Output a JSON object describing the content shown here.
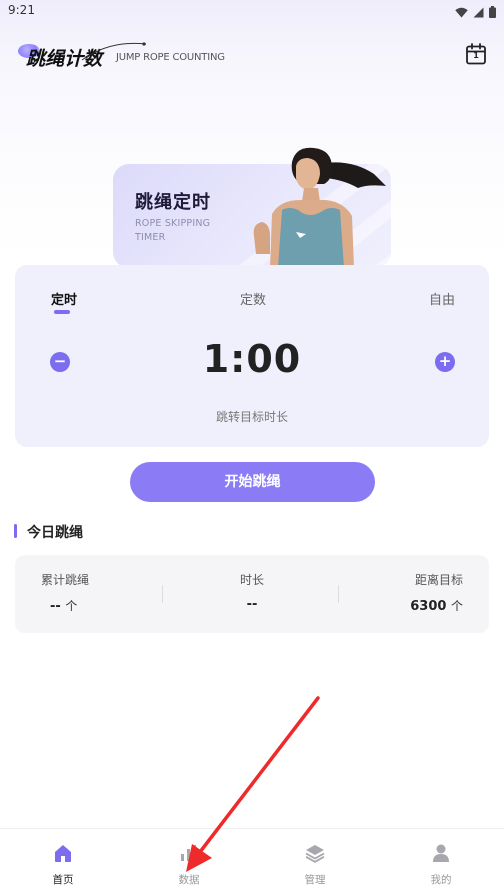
{
  "status_bar": {
    "time": "9:21",
    "icons": [
      "wifi-icon",
      "signal-icon",
      "battery-icon"
    ]
  },
  "header": {
    "logo_text": "跳绳计数",
    "logo_subtitle": "JUMP ROPE COUNTING",
    "calendar_day": "1"
  },
  "banner": {
    "title": "跳绳定时",
    "subtitle_line1": "ROPE SKIPPING",
    "subtitle_line2": "TIMER"
  },
  "timer": {
    "modes": [
      "定时",
      "定数",
      "自由"
    ],
    "active_mode": "定时",
    "value": "1:00",
    "hint": "跳转目标时长",
    "decrease_symbol": "−",
    "increase_symbol": "+"
  },
  "start_button": {
    "label": "开始跳绳"
  },
  "today": {
    "title": "今日跳绳",
    "stats": [
      {
        "label": "累计跳绳",
        "value": "--",
        "unit": "个"
      },
      {
        "label": "时长",
        "value": "--",
        "unit": ""
      },
      {
        "label": "距离目标",
        "value": "6300",
        "unit": "个"
      }
    ]
  },
  "tabbar": {
    "items": [
      {
        "label": "首页",
        "icon": "home-icon",
        "active": true
      },
      {
        "label": "数据",
        "icon": "bar-chart-icon",
        "active": false
      },
      {
        "label": "管理",
        "icon": "layers-icon",
        "active": false
      },
      {
        "label": "我的",
        "icon": "user-icon",
        "active": false
      }
    ]
  },
  "colors": {
    "accent": "#7c6cf0",
    "button": "#8b7cf6",
    "annotation_arrow": "#ee2a2a"
  }
}
